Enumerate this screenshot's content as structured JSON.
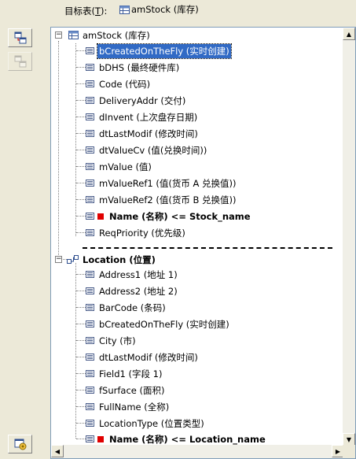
{
  "target": {
    "label_prefix": "目标表(",
    "label_key": "T",
    "label_suffix": "):",
    "table_name": "amStock (库存)"
  },
  "toolbar": {
    "buttons": [
      {
        "icon": "add-link-icon",
        "enabled": true
      },
      {
        "icon": "remove-link-icon",
        "enabled": false
      },
      {
        "icon": "settings-icon",
        "enabled": true
      }
    ]
  },
  "tree": {
    "root": {
      "label": "amStock (库存)",
      "fields": [
        {
          "label": "bCreatedOnTheFly (实时创建)",
          "selected": true
        },
        {
          "label": "bDHS (最终硬件库)"
        },
        {
          "label": "Code (代码)"
        },
        {
          "label": "DeliveryAddr (交付)"
        },
        {
          "label": "dInvent (上次盘存日期)"
        },
        {
          "label": "dtLastModif (修改时间)"
        },
        {
          "label": "dtValueCv (值(兑换时间))"
        },
        {
          "label": "mValue (值)"
        },
        {
          "label": "mValueRef1 (值(货币 A 兑换值))"
        },
        {
          "label": "mValueRef2 (值(货币 B 兑换值))"
        },
        {
          "label": "Name (名称)  <=  Stock_name",
          "key": true,
          "bold": true
        },
        {
          "label": "ReqPriority (优先级)"
        }
      ]
    },
    "link": {
      "label": "Location (位置)",
      "fields": [
        {
          "label": "Address1 (地址 1)"
        },
        {
          "label": "Address2 (地址 2)"
        },
        {
          "label": "BarCode (条码)"
        },
        {
          "label": "bCreatedOnTheFly (实时创建)"
        },
        {
          "label": "City (市)"
        },
        {
          "label": "dtLastModif (修改时间)"
        },
        {
          "label": "Field1 (字段 1)"
        },
        {
          "label": "fSurface (面积)"
        },
        {
          "label": "FullName (全称)"
        },
        {
          "label": "LocationType (位置类型)"
        },
        {
          "label": "Name (名称)  <=  Location_name",
          "key": true,
          "bold": true
        }
      ]
    }
  },
  "colors": {
    "selection": "#316ac5",
    "key_marker": "#e00000",
    "window_bg": "#ece9d8"
  }
}
